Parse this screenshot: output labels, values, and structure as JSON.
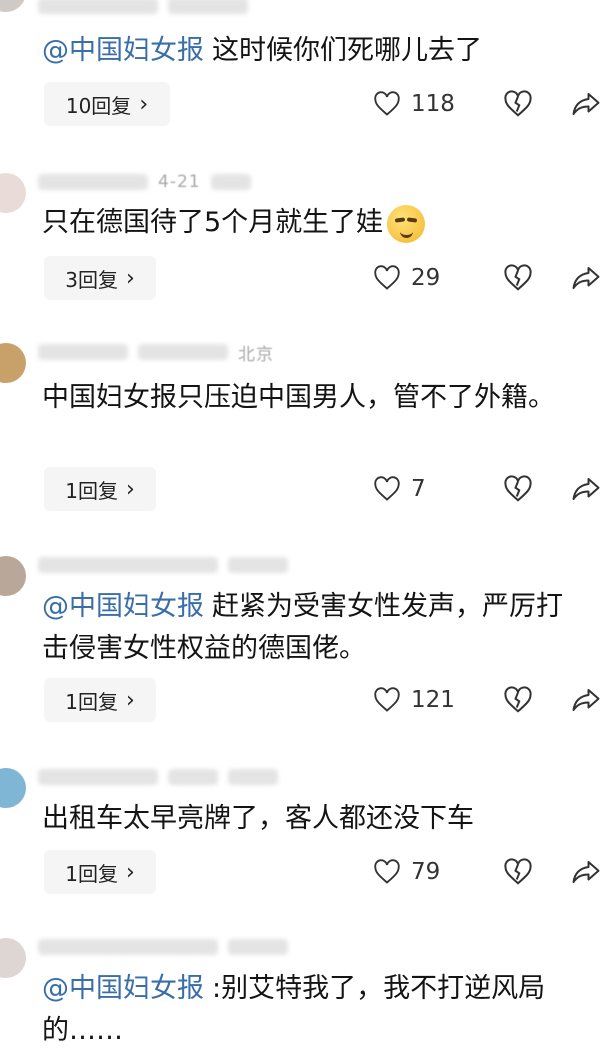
{
  "comments": [
    {
      "mention": "@中国妇女报",
      "text": "这时候你们死哪儿去了",
      "reply_label": "10回复",
      "like_count": "118"
    },
    {
      "meta_date": "4-21",
      "text": "只在德国待了5个月就生了娃",
      "reply_label": "3回复",
      "like_count": "29"
    },
    {
      "meta_location": "北京",
      "text": "中国妇女报只压迫中国男人，管不了外籍。",
      "reply_label": "1回复",
      "like_count": "7"
    },
    {
      "mention": "@中国妇女报",
      "text": "赶紧为受害女性发声，严厉打击侵害女性权益的德国佬。",
      "reply_label": "1回复",
      "like_count": "121"
    },
    {
      "text": "出租车太早亮牌了，客人都还没下车",
      "reply_label": "1回复",
      "like_count": "79"
    },
    {
      "mention": "@中国妇女报",
      "text": ":别艾特我了，我不打逆风局的……"
    }
  ],
  "icons": {
    "like": "heart-outline-icon",
    "unlike": "broken-heart-icon",
    "share": "share-arrow-icon",
    "emoji": "smirk-emoji-icon"
  }
}
